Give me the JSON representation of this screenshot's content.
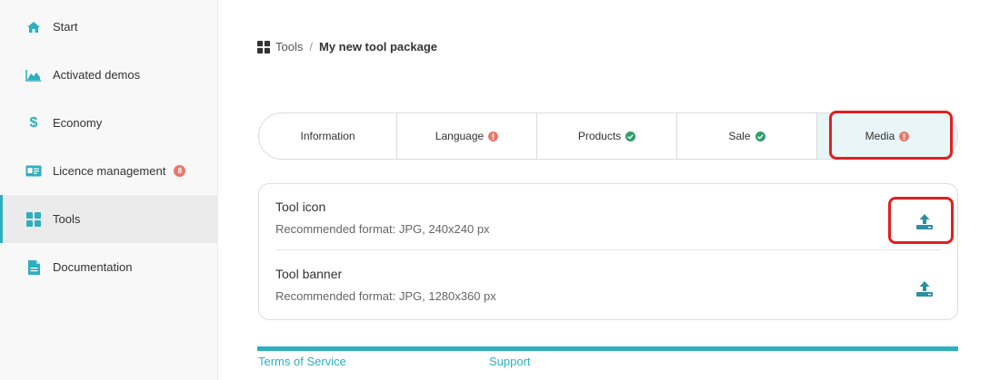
{
  "sidebar": {
    "items": [
      {
        "label": "Start",
        "icon": "home-icon"
      },
      {
        "label": "Activated demos",
        "icon": "area-chart-icon"
      },
      {
        "label": "Economy",
        "icon": "dollar-icon"
      },
      {
        "label": "Licence management",
        "icon": "id-card-icon",
        "badge": "8"
      },
      {
        "label": "Tools",
        "icon": "grid-icon",
        "active": true
      },
      {
        "label": "Documentation",
        "icon": "document-icon"
      }
    ]
  },
  "breadcrumb": {
    "root": "Tools",
    "separator": "/",
    "current": "My new tool package"
  },
  "tabs": [
    {
      "label": "Information",
      "status": "none"
    },
    {
      "label": "Language",
      "status": "error"
    },
    {
      "label": "Products",
      "status": "ok"
    },
    {
      "label": "Sale",
      "status": "ok"
    },
    {
      "label": "Media",
      "status": "error",
      "active": true
    }
  ],
  "media": {
    "rows": [
      {
        "title": "Tool icon",
        "hint": "Recommended format: JPG, 240x240 px"
      },
      {
        "title": "Tool banner",
        "hint": "Recommended format: JPG, 1280x360 px"
      }
    ]
  },
  "footer": {
    "terms": "Terms of Service",
    "support": "Support"
  },
  "colors": {
    "accent": "#2eafbd",
    "error": "#e8786a",
    "ok": "#2e9e6b",
    "highlight": "#e02020"
  }
}
